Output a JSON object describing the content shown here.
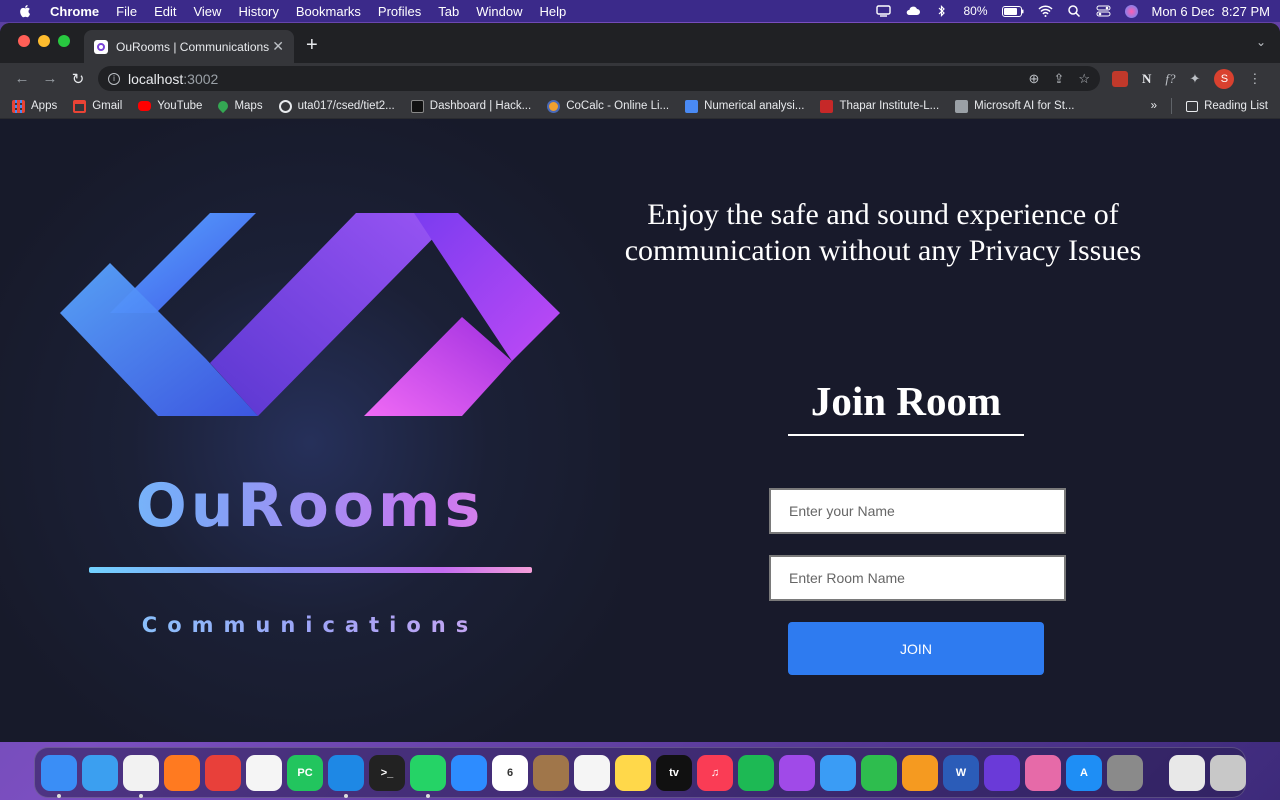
{
  "menubar": {
    "app_name": "Chrome",
    "items": [
      "File",
      "Edit",
      "View",
      "History",
      "Bookmarks",
      "Profiles",
      "Tab",
      "Window",
      "Help"
    ],
    "battery": "80%",
    "datetime": "Mon 6 Dec  8:27 PM"
  },
  "browser": {
    "tab_title": "OuRooms | Communications",
    "url_host": "localhost",
    "url_port": ":3002",
    "bookmarks": [
      {
        "label": "Apps",
        "icon": "apps-grid-icon",
        "color": "#e8eaed"
      },
      {
        "label": "Gmail",
        "icon": "gmail-icon",
        "color": "#ea4335"
      },
      {
        "label": "YouTube",
        "icon": "youtube-icon",
        "color": "#ff0000"
      },
      {
        "label": "Maps",
        "icon": "maps-icon",
        "color": "#34a853"
      },
      {
        "label": "uta017/csed/tiet2...",
        "icon": "globe-icon",
        "color": "#e8eaed"
      },
      {
        "label": "Dashboard | Hack...",
        "icon": "hackerrank-icon",
        "color": "#111111"
      },
      {
        "label": "CoCalc - Online Li...",
        "icon": "cocalc-icon",
        "color": "#f0a030"
      },
      {
        "label": "Numerical analysi...",
        "icon": "docs-icon",
        "color": "#4a8af4"
      },
      {
        "label": "Thapar Institute-L...",
        "icon": "thapar-icon",
        "color": "#c62828"
      },
      {
        "label": "Microsoft AI for St...",
        "icon": "microsoft-icon",
        "color": "#e8eaed"
      }
    ],
    "reading_list": "Reading List",
    "more_bookmarks": "»"
  },
  "page": {
    "brand_title": "OuRooms",
    "brand_subtitle": "Communications",
    "tagline": "Enjoy the safe and sound experience of communication without any Privacy Issues",
    "join_heading": "Join Room",
    "name_placeholder": "Enter your Name",
    "room_placeholder": "Enter Room Name",
    "join_button": "JOIN",
    "colors": {
      "page_bg": "#181a2b",
      "button": "#2e7bf0",
      "logo_blue": "#4a6cf0",
      "logo_purple": "#8a3ef0",
      "logo_magenta": "#d64af5"
    }
  },
  "dock": {
    "apps": [
      {
        "name": "finder-icon",
        "color": "#3a8ef6",
        "glyph": ""
      },
      {
        "name": "safari-icon",
        "color": "#3b9ff0",
        "glyph": ""
      },
      {
        "name": "chrome-icon",
        "color": "#f2f2f2",
        "glyph": ""
      },
      {
        "name": "firefox-icon",
        "color": "#ff7a20",
        "glyph": ""
      },
      {
        "name": "mail-icon",
        "color": "#e8403a",
        "glyph": ""
      },
      {
        "name": "photos-icon",
        "color": "#f5f5f5",
        "glyph": ""
      },
      {
        "name": "pycharm-icon",
        "color": "#22c55e",
        "glyph": "PC"
      },
      {
        "name": "vscode-icon",
        "color": "#1e88e5",
        "glyph": ""
      },
      {
        "name": "terminal-icon",
        "color": "#222222",
        "glyph": ">_"
      },
      {
        "name": "whatsapp-icon",
        "color": "#25d366",
        "glyph": ""
      },
      {
        "name": "zoom-icon",
        "color": "#2d8cff",
        "glyph": ""
      },
      {
        "name": "calendar-icon",
        "color": "#ffffff",
        "glyph": "6"
      },
      {
        "name": "contacts-icon",
        "color": "#a0764a",
        "glyph": ""
      },
      {
        "name": "reminders-icon",
        "color": "#f5f5f5",
        "glyph": ""
      },
      {
        "name": "notes-icon",
        "color": "#ffd84a",
        "glyph": ""
      },
      {
        "name": "appletv-icon",
        "color": "#111111",
        "glyph": "tv"
      },
      {
        "name": "music-icon",
        "color": "#fa3c55",
        "glyph": "♫"
      },
      {
        "name": "spotify-icon",
        "color": "#1db954",
        "glyph": ""
      },
      {
        "name": "podcasts-icon",
        "color": "#a04ae8",
        "glyph": ""
      },
      {
        "name": "keynote-icon",
        "color": "#3a9cf5",
        "glyph": ""
      },
      {
        "name": "numbers-icon",
        "color": "#2ebd4e",
        "glyph": ""
      },
      {
        "name": "pages-icon",
        "color": "#f59a20",
        "glyph": ""
      },
      {
        "name": "word-icon",
        "color": "#2b5cb8",
        "glyph": "W"
      },
      {
        "name": "vpn-icon",
        "color": "#6a3ad8",
        "glyph": ""
      },
      {
        "name": "cleanmymac-icon",
        "color": "#e66aa8",
        "glyph": ""
      },
      {
        "name": "appstore-icon",
        "color": "#1e8ef5",
        "glyph": "A"
      },
      {
        "name": "system-preferences-icon",
        "color": "#8a8a8a",
        "glyph": ""
      }
    ],
    "trailing": [
      {
        "name": "documents-stack-icon",
        "color": "#e8e8e8",
        "glyph": ""
      },
      {
        "name": "trash-icon",
        "color": "#c8c8c8",
        "glyph": ""
      }
    ]
  }
}
